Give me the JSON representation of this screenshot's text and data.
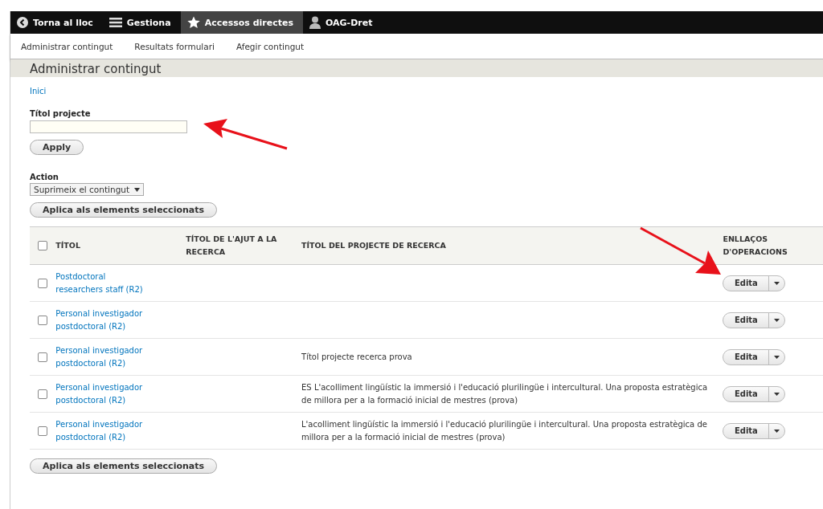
{
  "toolbar": {
    "items": [
      {
        "kind": "back",
        "label": "Torna al lloc",
        "selected": false
      },
      {
        "kind": "menu",
        "label": "Gestiona",
        "selected": false
      },
      {
        "kind": "star",
        "label": "Accessos directes",
        "selected": true
      },
      {
        "kind": "user",
        "label": "OAG-Dret",
        "selected": false
      }
    ]
  },
  "tray": {
    "links": [
      "Administrar contingut",
      "Resultats formulari",
      "Afegir contingut"
    ]
  },
  "page_title": "Administrar contingut",
  "breadcrumb": "Inici",
  "filter": {
    "label": "Títol projecte",
    "apply": "Apply"
  },
  "action": {
    "label": "Action",
    "value": "Suprimeix el contingut",
    "button": "Aplica als elements seleccionats"
  },
  "table": {
    "select_all_checked": false,
    "columns": [
      "TÍTOL",
      "TÍTOL DE L'AJUT A LA RECERCA",
      "TÍTOL DEL PROJECTE DE RECERCA",
      "ENLLAÇOS D'OPERACIONS"
    ],
    "rows": [
      {
        "checked": false,
        "title": "Postdoctoral researchers staff (R2)",
        "operation": "Edita"
      },
      {
        "checked": false,
        "title": "Personal investigador postdoctoral (R2)",
        "operation": "Edita"
      },
      {
        "checked": false,
        "title": "Personal investigador postdoctoral (R2)",
        "project": "Títol projecte recerca prova",
        "operation": "Edita"
      },
      {
        "checked": false,
        "title": "Personal investigador postdoctoral (R2)",
        "project": "ES L'acolliment lingüístic la immersió i l'educació plurilingüe i intercultural. Una proposta estratègica de millora per a la formació inicial de mestres (prova)",
        "operation": "Edita"
      },
      {
        "checked": false,
        "title": "Personal investigador postdoctoral (R2)",
        "project": "L'acolliment lingüístic la immersió i l'educació plurilingüe i intercultural. Una proposta estratègica de millora per a la formació inicial de mestres (prova)",
        "operation": "Edita"
      }
    ]
  },
  "bottom_button": "Aplica als elements seleccionats"
}
